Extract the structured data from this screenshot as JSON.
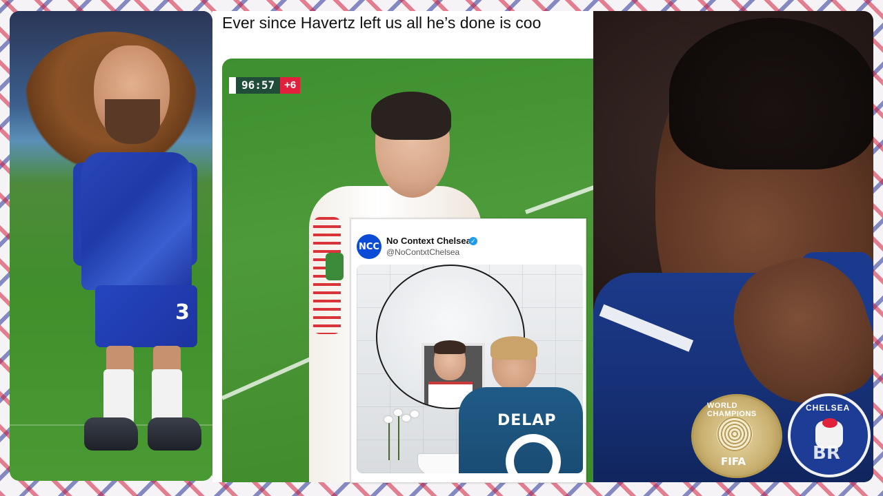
{
  "caption": "Ever since Havertz left us all he’s done is coo",
  "scoreboard": {
    "time": "96:57",
    "added_time": "+6"
  },
  "tweet": {
    "avatar_text": "NCC",
    "name": "No Context Chelsea",
    "handle": "@NoContxtChelsea",
    "verified_icon": "check-icon",
    "jersey_name": "DELAP"
  },
  "right_image": {
    "badge_top_text": "WORLD CHAMPIONS",
    "badge_text": "FIFA",
    "crest_text": "CHELSEA"
  },
  "colors": {
    "chelsea_blue": "#1f3aa8",
    "score_green": "#1f4d3a",
    "score_red": "#e0203c",
    "verified_blue": "#1d9bf0"
  }
}
